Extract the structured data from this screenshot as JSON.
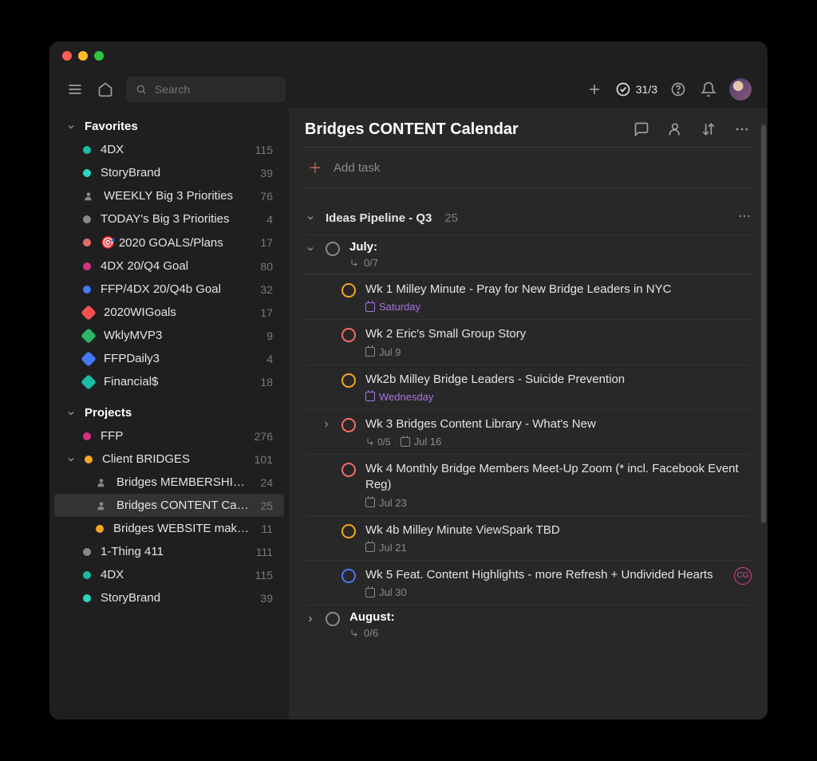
{
  "search": {
    "placeholder": "Search"
  },
  "topbar": {
    "progress": "31/3"
  },
  "sidebar": {
    "favorites_label": "Favorites",
    "projects_label": "Projects",
    "favorites": [
      {
        "label": "4DX",
        "count": "115",
        "color": "#1bbca3",
        "type": "dot"
      },
      {
        "label": "StoryBrand",
        "count": "39",
        "color": "#2dd4bf",
        "type": "dot"
      },
      {
        "label": "WEEKLY Big 3 Priorities",
        "count": "76",
        "color": "#888",
        "type": "person"
      },
      {
        "label": "TODAY's Big 3 Priorities",
        "count": "4",
        "color": "#888",
        "type": "dot"
      },
      {
        "label": "🎯 2020 GOALS/Plans",
        "count": "17",
        "color": "#e56b6b",
        "type": "dot"
      },
      {
        "label": "4DX 20/Q4 Goal",
        "count": "80",
        "color": "#d63384",
        "type": "dot"
      },
      {
        "label": "FFP/4DX 20/Q4b Goal",
        "count": "32",
        "color": "#4578f5",
        "type": "dot"
      },
      {
        "label": "2020WIGoals",
        "count": "17",
        "color": "#f54f4f",
        "type": "tag"
      },
      {
        "label": "WklyMVP3",
        "count": "9",
        "color": "#2db56a",
        "type": "tag"
      },
      {
        "label": "FFPDaily3",
        "count": "4",
        "color": "#4578f5",
        "type": "tag"
      },
      {
        "label": "Financial$",
        "count": "18",
        "color": "#1bbca3",
        "type": "tag"
      }
    ],
    "projects": [
      {
        "label": "FFP",
        "count": "276",
        "color": "#d63384",
        "indent": 0,
        "type": "dot"
      },
      {
        "label": "Client BRIDGES",
        "count": "101",
        "color": "#f5a623",
        "indent": 0,
        "type": "dot",
        "expanded": true
      },
      {
        "label": "Bridges MEMBERSHIP …",
        "count": "24",
        "color": "#888",
        "indent": 1,
        "type": "person"
      },
      {
        "label": "Bridges CONTENT Cal…",
        "count": "25",
        "color": "#888",
        "indent": 1,
        "type": "person",
        "selected": true
      },
      {
        "label": "Bridges WEBSITE make…",
        "count": "11",
        "color": "#f5a623",
        "indent": 1,
        "type": "dot"
      },
      {
        "label": "1-Thing 411",
        "count": "111",
        "color": "#888",
        "indent": 0,
        "type": "dot"
      },
      {
        "label": "4DX",
        "count": "115",
        "color": "#1bbca3",
        "indent": 0,
        "type": "dot"
      },
      {
        "label": "StoryBrand",
        "count": "39",
        "color": "#2dd4bf",
        "indent": 0,
        "type": "dot"
      }
    ]
  },
  "page": {
    "title": "Bridges CONTENT Calendar",
    "add_task": "Add task",
    "section": {
      "label": "Ideas Pipeline - Q3",
      "count": "25"
    },
    "months": [
      {
        "label": "July:",
        "subtasks": "0/7"
      },
      {
        "label": "August:",
        "subtasks": "0/6"
      }
    ],
    "tasks": [
      {
        "title": "Wk 1 Milley Minute - Pray for New Bridge Leaders in NYC",
        "date": "Saturday",
        "date_style": "purple",
        "circle": "#f5a623"
      },
      {
        "title": "Wk 2 Eric's Small Group Story",
        "date": "Jul 9",
        "date_style": "grey",
        "circle": "#f56b6b"
      },
      {
        "title": "Wk2b Milley Bridge Leaders - Suicide Prevention",
        "date": "Wednesday",
        "date_style": "purple",
        "circle": "#f5a623"
      },
      {
        "title": "Wk 3 Bridges Content Library - What's New",
        "date": "Jul 16",
        "date_style": "grey",
        "circle": "#f56b6b",
        "subtasks": "0/5",
        "expandable": true
      },
      {
        "title": "Wk 4 Monthly Bridge Members Meet-Up Zoom (* incl. Facebook Event Reg)",
        "date": "Jul 23",
        "date_style": "grey",
        "circle": "#f56b6b"
      },
      {
        "title": "Wk 4b Milley Minute ViewSpark TBD",
        "date": "Jul 21",
        "date_style": "grey",
        "circle": "#f5a623"
      },
      {
        "title": "Wk 5 Feat. Content Highlights - more Refresh + Undivided Hearts",
        "date": "Jul 30",
        "date_style": "grey",
        "circle": "#4578f5",
        "assignee": "CG"
      }
    ]
  }
}
